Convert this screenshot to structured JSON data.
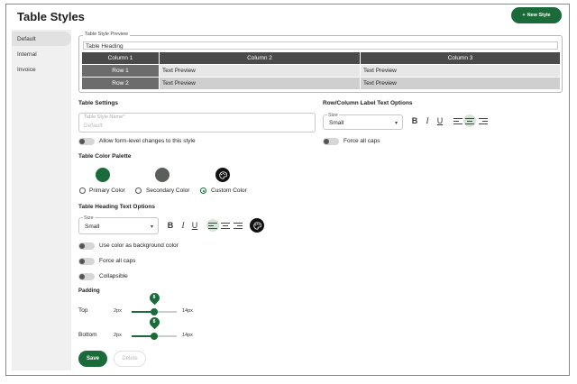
{
  "header": {
    "title": "Table Styles",
    "new_style_label": "New Style"
  },
  "sidebar": {
    "items": [
      {
        "label": "Default",
        "active": true
      },
      {
        "label": "Internal"
      },
      {
        "label": "Invoice"
      }
    ]
  },
  "preview": {
    "legend": "Table Style Preview",
    "heading": "Table Heading",
    "columns": [
      "Column 1",
      "Column 2",
      "Column 3"
    ],
    "rows": [
      {
        "label": "Row 1",
        "cells": [
          "Text Preview",
          "Text Preview"
        ]
      },
      {
        "label": "Row 2",
        "cells": [
          "Text Preview",
          "Text Preview"
        ]
      }
    ]
  },
  "table_settings": {
    "title": "Table Settings",
    "name_label": "Table Style Name*",
    "name_value": "Default",
    "allow_form_changes_label": "Allow form-level changes to this style"
  },
  "label_text_options": {
    "title": "Row/Column Label Text Options",
    "size_label": "Size",
    "size_value": "Small",
    "force_caps_label": "Force all caps"
  },
  "palette": {
    "title": "Table Color Palette",
    "options": [
      {
        "label": "Primary Color",
        "color": "#1b6b3a",
        "selected": false
      },
      {
        "label": "Secondary Color",
        "color": "#5b5f5c",
        "selected": false
      },
      {
        "label": "Custom Color",
        "color": "#111111",
        "selected": true
      }
    ]
  },
  "heading_text_options": {
    "title": "Table Heading Text Options",
    "size_label": "Size",
    "size_value": "Small",
    "use_bg_label": "Use color as background color",
    "force_caps_label": "Force all caps",
    "collapsible_label": "Collapsible"
  },
  "padding": {
    "title": "Padding",
    "top": {
      "label": "Top",
      "min": "2px",
      "max": "14px",
      "value": "8",
      "fraction": 0.5
    },
    "bottom": {
      "label": "Bottom",
      "min": "2px",
      "max": "14px",
      "value": "8",
      "fraction": 0.5
    }
  },
  "format_icons": {
    "bold": "B",
    "italic": "I",
    "underline": "U"
  },
  "actions": {
    "save_label": "Save",
    "delete_label": "Delete"
  },
  "colors": {
    "accent": "#1b6b3a"
  }
}
